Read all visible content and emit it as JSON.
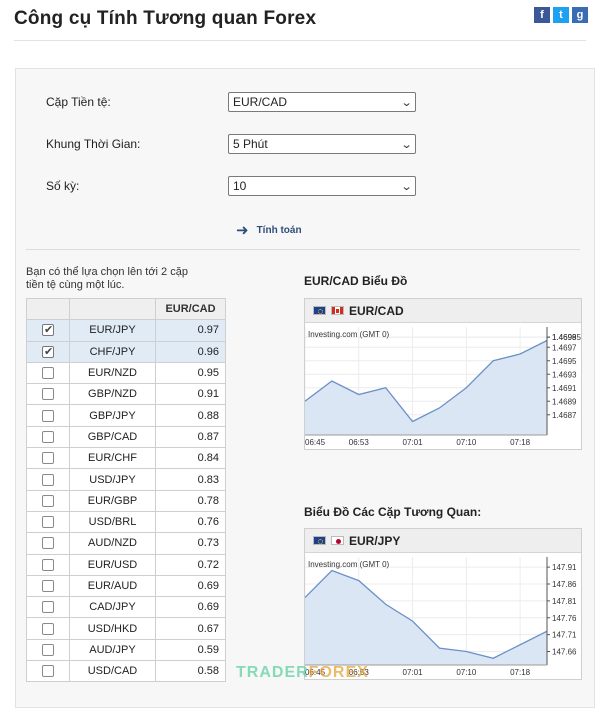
{
  "header": {
    "title": "Công cụ Tính Tương quan Forex"
  },
  "social": [
    {
      "name": "facebook-icon",
      "glyph": "f"
    },
    {
      "name": "twitter-icon",
      "glyph": "t"
    },
    {
      "name": "google-plus-icon",
      "glyph": "g"
    }
  ],
  "form": {
    "pair_label": "Cặp Tiền tệ:",
    "pair_value": "EUR/CAD",
    "timeframe_label": "Khung Thời Gian:",
    "timeframe_value": "5 Phút",
    "periods_label": "Số kỳ:",
    "periods_value": "10",
    "calculate_label": "Tính toán"
  },
  "table": {
    "note": "Bạn có thể lựa chọn lên tới 2 cặp tiền tệ cùng một lúc.",
    "header": "EUR/CAD",
    "rows": [
      {
        "pair": "EUR/JPY",
        "value": "0.97",
        "checked": true
      },
      {
        "pair": "CHF/JPY",
        "value": "0.96",
        "checked": true
      },
      {
        "pair": "EUR/NZD",
        "value": "0.95",
        "checked": false
      },
      {
        "pair": "GBP/NZD",
        "value": "0.91",
        "checked": false
      },
      {
        "pair": "GBP/JPY",
        "value": "0.88",
        "checked": false
      },
      {
        "pair": "GBP/CAD",
        "value": "0.87",
        "checked": false
      },
      {
        "pair": "EUR/CHF",
        "value": "0.84",
        "checked": false
      },
      {
        "pair": "USD/JPY",
        "value": "0.83",
        "checked": false
      },
      {
        "pair": "EUR/GBP",
        "value": "0.78",
        "checked": false
      },
      {
        "pair": "USD/BRL",
        "value": "0.76",
        "checked": false
      },
      {
        "pair": "AUD/NZD",
        "value": "0.73",
        "checked": false
      },
      {
        "pair": "EUR/USD",
        "value": "0.72",
        "checked": false
      },
      {
        "pair": "EUR/AUD",
        "value": "0.69",
        "checked": false
      },
      {
        "pair": "CAD/JPY",
        "value": "0.69",
        "checked": false
      },
      {
        "pair": "USD/HKD",
        "value": "0.67",
        "checked": false
      },
      {
        "pair": "AUD/JPY",
        "value": "0.59",
        "checked": false
      },
      {
        "pair": "USD/CAD",
        "value": "0.58",
        "checked": false
      }
    ]
  },
  "charts": {
    "main_title": "EUR/CAD Biểu Đồ",
    "corr_title": "Biểu Đồ Các Cặp Tương Quan:",
    "source": "Investing.com (GMT 0)"
  },
  "watermark": {
    "text1": "TRADER",
    "text2": "FOREX"
  },
  "colors": {
    "line": "#6b91c8",
    "fill": "#dbe6f4",
    "accent": "#2d4e79"
  },
  "chart_data": [
    {
      "type": "area",
      "pair": "EUR/CAD",
      "x": [
        "06:45",
        "06:53",
        "07:01",
        "07:10",
        "07:18"
      ],
      "x_label_index": [
        0,
        2,
        4,
        6,
        8
      ],
      "values": [
        1.4689,
        1.4692,
        1.469,
        1.4691,
        1.4686,
        1.4688,
        1.4691,
        1.4695,
        1.4696,
        1.4698
      ],
      "y_ticks": [
        1.46985,
        1.4697,
        1.4695,
        1.4693,
        1.4691,
        1.4689,
        1.4687,
        1.46985
      ],
      "y_tick_labels": [
        "1.4699",
        "1.4697",
        "1.4695",
        "1.4693",
        "1.4691",
        "1.4689",
        "1.4687",
        "1.46985"
      ],
      "ylim": [
        1.4684,
        1.47
      ]
    },
    {
      "type": "area",
      "pair": "EUR/JPY",
      "x": [
        "06:45",
        "06:53",
        "07:01",
        "07:10",
        "07:18"
      ],
      "x_label_index": [
        0,
        2,
        4,
        6,
        8
      ],
      "values": [
        147.82,
        147.9,
        147.87,
        147.8,
        147.75,
        147.67,
        147.66,
        147.64,
        147.68,
        147.72
      ],
      "y_ticks": [
        147.91,
        147.86,
        147.81,
        147.76,
        147.71,
        147.66
      ],
      "y_tick_labels": [
        "147.91",
        "147.86",
        "147.81",
        "147.76",
        "147.71",
        "147.66"
      ],
      "ylim": [
        147.62,
        147.94
      ]
    }
  ]
}
